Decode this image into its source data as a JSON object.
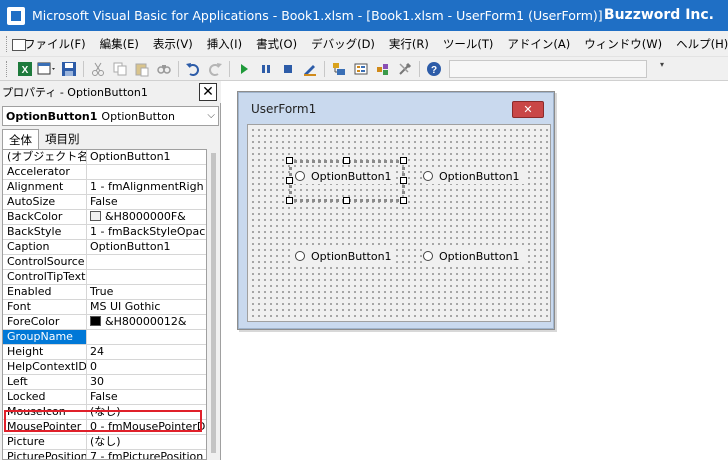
{
  "window": {
    "title": "Microsoft Visual Basic for Applications - Book1.xlsm - [Book1.xlsm - UserForm1 (UserForm)]",
    "brand": "Buzzword Inc."
  },
  "menu": {
    "items": [
      {
        "label": "ファイル(F)"
      },
      {
        "label": "編集(E)"
      },
      {
        "label": "表示(V)"
      },
      {
        "label": "挿入(I)"
      },
      {
        "label": "書式(O)"
      },
      {
        "label": "デバッグ(D)"
      },
      {
        "label": "実行(R)"
      },
      {
        "label": "ツール(T)"
      },
      {
        "label": "アドイン(A)"
      },
      {
        "label": "ウィンドウ(W)"
      },
      {
        "label": "ヘルプ(H)"
      }
    ]
  },
  "toolbar": {
    "icons": [
      "excel-icon",
      "insert-userform-icon",
      "save-icon",
      "cut-icon",
      "copy-icon",
      "paste-icon",
      "find-icon",
      "undo-icon",
      "redo-icon",
      "run-icon",
      "break-icon",
      "reset-icon",
      "design-mode-icon",
      "project-explorer-icon",
      "properties-icon",
      "object-browser-icon",
      "toolbox-icon",
      "help-icon"
    ]
  },
  "properties": {
    "title": "プロパティ - OptionButton1",
    "object_name": "OptionButton1",
    "object_type": "OptionButton",
    "tabs": [
      {
        "label": "全体"
      },
      {
        "label": "項目別"
      }
    ],
    "rows": [
      {
        "name": "(オブジェクト名)",
        "value": "OptionButton1"
      },
      {
        "name": "Accelerator",
        "value": ""
      },
      {
        "name": "Alignment",
        "value": "1 - fmAlignmentRigh"
      },
      {
        "name": "AutoSize",
        "value": "False"
      },
      {
        "name": "BackColor",
        "value": "&H8000000F&",
        "swatch": "#f0f0f0"
      },
      {
        "name": "BackStyle",
        "value": "1 - fmBackStyleOpac"
      },
      {
        "name": "Caption",
        "value": "OptionButton1"
      },
      {
        "name": "ControlSource",
        "value": ""
      },
      {
        "name": "ControlTipText",
        "value": ""
      },
      {
        "name": "Enabled",
        "value": "True"
      },
      {
        "name": "Font",
        "value": "MS UI Gothic"
      },
      {
        "name": "ForeColor",
        "value": "&H80000012&",
        "swatch": "#000000"
      },
      {
        "name": "GroupName",
        "value": "",
        "selected": true
      },
      {
        "name": "Height",
        "value": "24"
      },
      {
        "name": "HelpContextID",
        "value": "0"
      },
      {
        "name": "Left",
        "value": "30"
      },
      {
        "name": "Locked",
        "value": "False"
      },
      {
        "name": "MouseIcon",
        "value": "(なし)"
      },
      {
        "name": "MousePointer",
        "value": "0 - fmMousePointerD"
      },
      {
        "name": "Picture",
        "value": "(なし)"
      },
      {
        "name": "PicturePosition",
        "value": "7 - fmPicturePosition"
      }
    ]
  },
  "userform": {
    "title": "UserForm1",
    "close_label": "✕",
    "options": [
      {
        "caption": "OptionButton1"
      },
      {
        "caption": "OptionButton1"
      },
      {
        "caption": "OptionButton1"
      },
      {
        "caption": "OptionButton1"
      }
    ]
  }
}
